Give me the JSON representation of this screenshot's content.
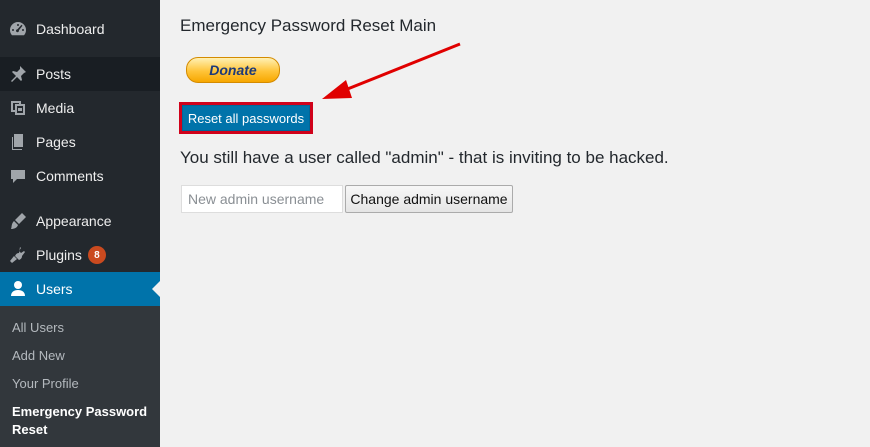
{
  "sidebar": {
    "items": [
      {
        "label": "Dashboard",
        "icon": "dashboard-icon"
      },
      {
        "label": "Posts",
        "icon": "pin-icon"
      },
      {
        "label": "Media",
        "icon": "media-icon"
      },
      {
        "label": "Pages",
        "icon": "pages-icon"
      },
      {
        "label": "Comments",
        "icon": "comment-icon"
      },
      {
        "label": "Appearance",
        "icon": "brush-icon"
      },
      {
        "label": "Plugins",
        "icon": "plugin-icon",
        "badge": "8"
      },
      {
        "label": "Users",
        "icon": "user-icon"
      }
    ],
    "submenu": [
      "All Users",
      "Add New",
      "Your Profile",
      "Emergency Password Reset"
    ]
  },
  "main": {
    "title": "Emergency Password Reset Main",
    "donate_label": "Donate",
    "reset_label": "Reset all passwords",
    "notice": "You still have a user called \"admin\" - that is inviting to be hacked.",
    "admin_placeholder": "New admin username",
    "change_label": "Change admin username"
  },
  "colors": {
    "sidebar_bg": "#23282d",
    "accent": "#0073aa",
    "highlight": "#d0021b",
    "badge": "#ca4a1f"
  }
}
